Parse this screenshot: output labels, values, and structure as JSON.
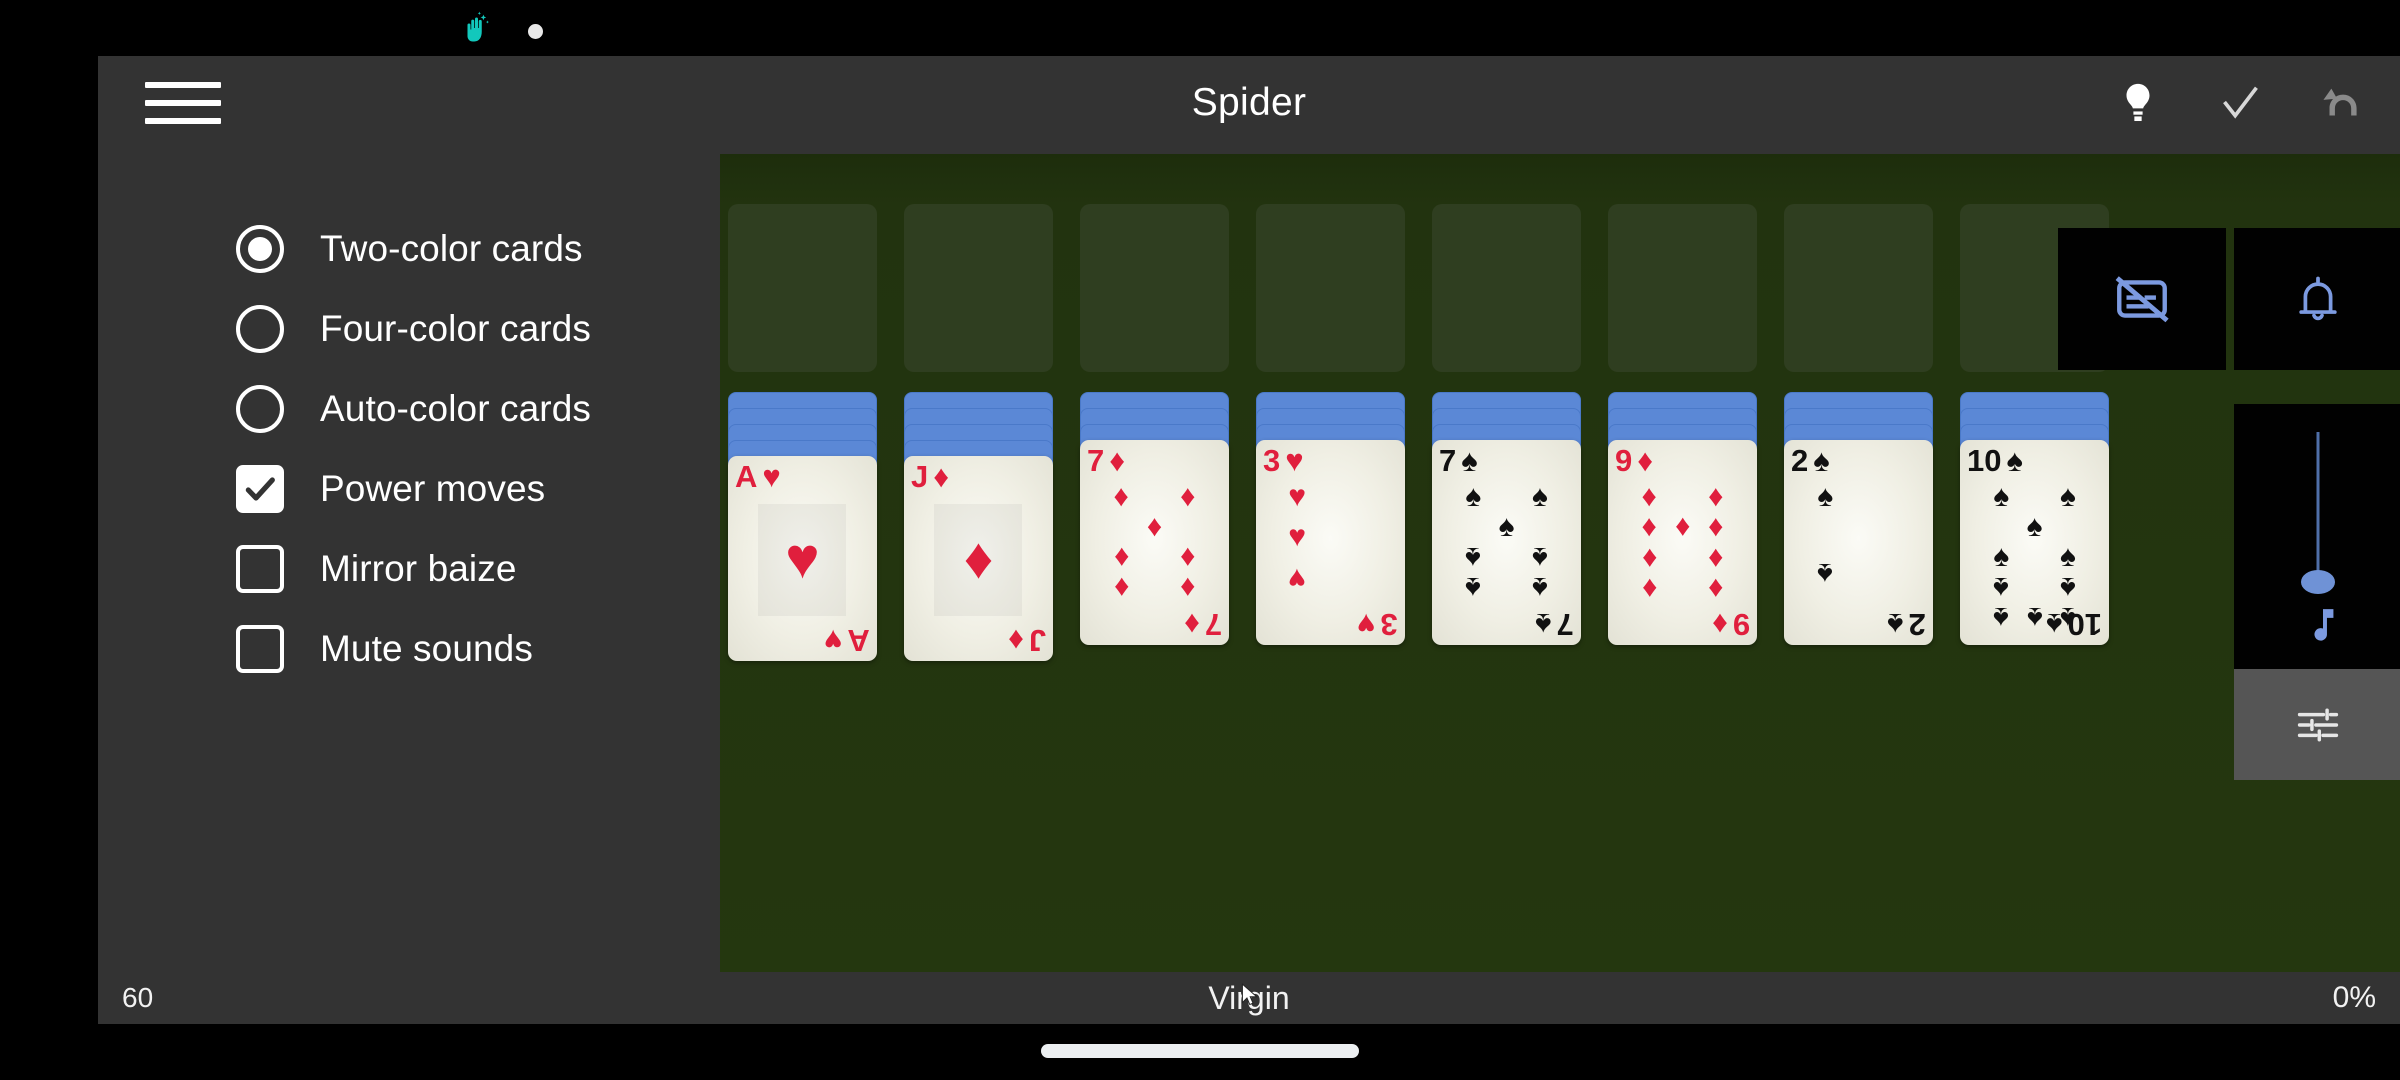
{
  "status_bar": {
    "icons": [
      "hand-sparkle-icon",
      "dot-icon"
    ]
  },
  "appbar": {
    "title": "Spider",
    "menu_icon": "hamburger-menu-icon",
    "actions": [
      {
        "name": "hint-button",
        "icon": "lightbulb-icon"
      },
      {
        "name": "confirm-button",
        "icon": "check-icon"
      },
      {
        "name": "undo-button",
        "icon": "undo-arrow-icon"
      }
    ]
  },
  "drawer": {
    "options": [
      {
        "type": "radio",
        "label": "Two-color cards",
        "checked": true,
        "name": "option-two-color-cards"
      },
      {
        "type": "radio",
        "label": "Four-color cards",
        "checked": false,
        "name": "option-four-color-cards"
      },
      {
        "type": "radio",
        "label": "Auto-color cards",
        "checked": false,
        "name": "option-auto-color-cards"
      },
      {
        "type": "checkbox",
        "label": "Power moves",
        "checked": true,
        "name": "option-power-moves"
      },
      {
        "type": "checkbox",
        "label": "Mirror baize",
        "checked": false,
        "name": "option-mirror-baize"
      },
      {
        "type": "checkbox",
        "label": "Mute sounds",
        "checked": false,
        "name": "option-mute-sounds"
      }
    ]
  },
  "board": {
    "foundation_slot_count": 8,
    "colors": {
      "baize": "#22330f",
      "slot": "#2f3e20",
      "card_back": "#5b88d6",
      "red_suit": "#e01f3d",
      "black_suit": "#111111"
    },
    "piles": [
      {
        "backs": 4,
        "rank": "A",
        "suit": "heart",
        "color": "red",
        "pips": 1
      },
      {
        "backs": 4,
        "rank": "J",
        "suit": "diamond",
        "color": "red",
        "pips": 1
      },
      {
        "backs": 3,
        "rank": "7",
        "suit": "diamond",
        "color": "red",
        "pips": 7
      },
      {
        "backs": 3,
        "rank": "3",
        "suit": "heart",
        "color": "red",
        "pips": 3
      },
      {
        "backs": 3,
        "rank": "7",
        "suit": "spade",
        "color": "black",
        "pips": 7
      },
      {
        "backs": 3,
        "rank": "9",
        "suit": "diamond",
        "color": "red",
        "pips": 9
      },
      {
        "backs": 3,
        "rank": "2",
        "suit": "spade",
        "color": "black",
        "pips": 2
      },
      {
        "backs": 3,
        "rank": "10",
        "suit": "spade",
        "color": "black",
        "pips": 10
      }
    ]
  },
  "overlay": {
    "subtitles_off": {
      "name": "subtitles-off-icon",
      "label": "subtitles-off"
    },
    "bell": {
      "name": "bell-icon",
      "label": "bell"
    },
    "volume": {
      "name": "volume-slider",
      "value": 55,
      "note_icon": "music-note-icon"
    },
    "equalizer": {
      "name": "equalizer-icon",
      "label": "settings-sliders"
    }
  },
  "bottom_bar": {
    "left": "60",
    "center": "Virgin",
    "right": "0%"
  }
}
